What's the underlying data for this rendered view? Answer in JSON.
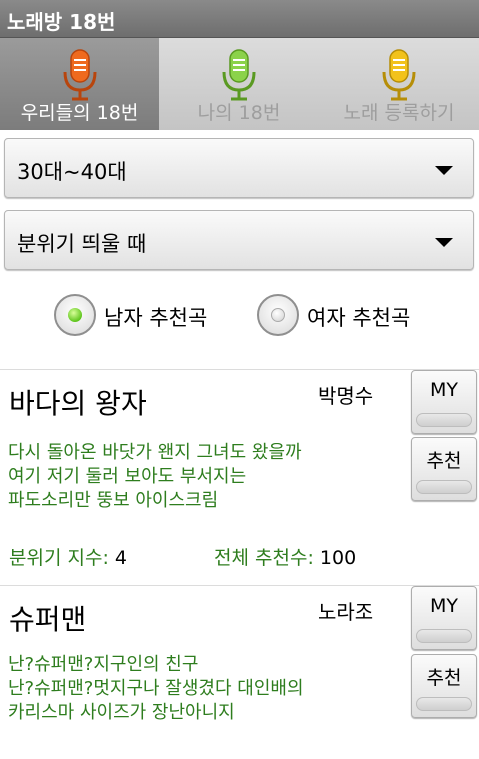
{
  "app": {
    "title": "노래방 18번"
  },
  "tabs": [
    {
      "label": "우리들의 18번",
      "icon": "microphone-orange-icon",
      "color": "#ef6a1e",
      "selected": true
    },
    {
      "label": "나의 18번",
      "icon": "microphone-green-icon",
      "color": "#8bd24a",
      "selected": false
    },
    {
      "label": "노래 등록하기",
      "icon": "microphone-yellow-icon",
      "color": "#f2c21b",
      "selected": false
    }
  ],
  "filters": {
    "age_group": "30대~40대",
    "mood": "분위기 띄울 때"
  },
  "gender": {
    "male_label": "남자 추천곡",
    "female_label": "여자 추천곡",
    "selected": "male"
  },
  "songs": [
    {
      "title": "바다의 왕자",
      "artist": "박명수",
      "lyrics": [
        "다시 돌아온 바닷가 왠지 그녀도 왔을까",
        "여기 저기 둘러 보아도 부서지는",
        "파도소리만 뚱보 아이스크림"
      ],
      "mood_label": "분위기 지수:",
      "mood_value": "4",
      "total_label": "전체 추천수:",
      "total_value": "100",
      "my_label": "MY",
      "recommend_label": "추천"
    },
    {
      "title": "슈퍼맨",
      "artist": "노라조",
      "lyrics": [
        "난?슈퍼맨?지구인의 친구",
        "난?슈퍼맨?멋지구나 잘생겼다 대인배의",
        "카리스마 사이즈가 장난아니지"
      ],
      "my_label": "MY",
      "recommend_label": "추천"
    }
  ]
}
